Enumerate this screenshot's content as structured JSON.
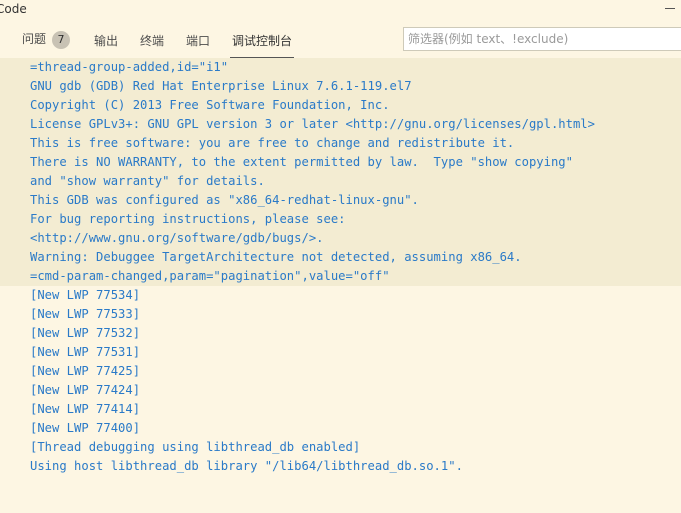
{
  "window": {
    "title": "Code"
  },
  "panel": {
    "tabs": [
      {
        "label": "问题",
        "badge": "7"
      },
      {
        "label": "输出"
      },
      {
        "label": "终端"
      },
      {
        "label": "端口"
      },
      {
        "label": "调试控制台",
        "active": true
      }
    ],
    "filter": {
      "value": "",
      "placeholder": "筛选器(例如 text、!exclude)"
    }
  },
  "console": {
    "text_color": "#2a7ac8",
    "highlight_color": "#f3ecd2",
    "highlighted_lines": [
      "=thread-group-added,id=\"i1\"",
      "GNU gdb (GDB) Red Hat Enterprise Linux 7.6.1-119.el7",
      "Copyright (C) 2013 Free Software Foundation, Inc.",
      "License GPLv3+: GNU GPL version 3 or later <http://gnu.org/licenses/gpl.html>",
      "This is free software: you are free to change and redistribute it.",
      "There is NO WARRANTY, to the extent permitted by law.  Type \"show copying\"",
      "and \"show warranty\" for details.",
      "This GDB was configured as \"x86_64-redhat-linux-gnu\".",
      "For bug reporting instructions, please see:",
      "<http://www.gnu.org/software/gdb/bugs/>.",
      "Warning: Debuggee TargetArchitecture not detected, assuming x86_64.",
      "=cmd-param-changed,param=\"pagination\",value=\"off\""
    ],
    "lines": [
      "[New LWP 77534]",
      "[New LWP 77533]",
      "[New LWP 77532]",
      "[New LWP 77531]",
      "[New LWP 77425]",
      "[New LWP 77424]",
      "[New LWP 77414]",
      "[New LWP 77400]",
      "[Thread debugging using libthread_db enabled]",
      "Using host libthread_db library \"/lib64/libthread_db.so.1\"."
    ]
  }
}
